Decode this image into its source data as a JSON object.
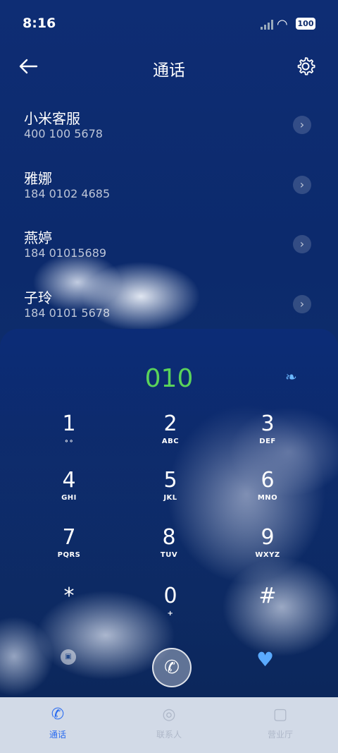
{
  "status_bar": {
    "time": "8:16",
    "battery": "100"
  },
  "header": {
    "title": "通话"
  },
  "contacts": [
    {
      "name": "小米客服",
      "number": "400 100 5678"
    },
    {
      "name": "雅娜",
      "number": "184 0102 4685"
    },
    {
      "name": "燕婷",
      "number": "184 01015689"
    },
    {
      "name": "子玲",
      "number": "184 0101 5678"
    }
  ],
  "dialpad": {
    "entered": "010",
    "keys": [
      {
        "digit": "1",
        "letters": ""
      },
      {
        "digit": "2",
        "letters": "ABC"
      },
      {
        "digit": "3",
        "letters": "DEF"
      },
      {
        "digit": "4",
        "letters": "GHI"
      },
      {
        "digit": "5",
        "letters": "JKL"
      },
      {
        "digit": "6",
        "letters": "MNO"
      },
      {
        "digit": "7",
        "letters": "PQRS"
      },
      {
        "digit": "8",
        "letters": "TUV"
      },
      {
        "digit": "9",
        "letters": "WXYZ"
      },
      {
        "digit": "*",
        "letters": ""
      },
      {
        "digit": "0",
        "letters": "+"
      },
      {
        "digit": "#",
        "letters": ""
      }
    ]
  },
  "tabs": [
    {
      "label": "通话",
      "icon": "phone-icon",
      "active": true
    },
    {
      "label": "联系人",
      "icon": "person-icon",
      "active": false
    },
    {
      "label": "营业厅",
      "icon": "shop-icon",
      "active": false
    }
  ],
  "colors": {
    "digits": "#5ad35a",
    "active_tab": "#2a6cf0",
    "background": "#0d2a6b"
  }
}
